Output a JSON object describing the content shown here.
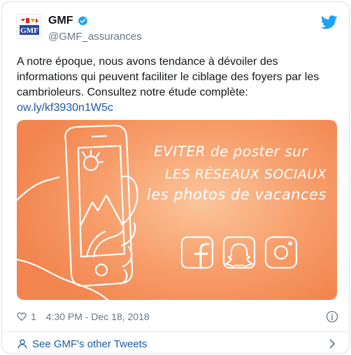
{
  "author": {
    "name": "GMF",
    "handle": "@GMF_assurances",
    "logo_text": "GMF",
    "verified": true
  },
  "tweet": {
    "text": "A notre époque, nous avons tendance à dévoiler des informations qui peuvent faciliter le ciblage des foyers par les cambrioleurs. Consultez notre étude complète:",
    "link": "ow.ly/kf3930n1W5c"
  },
  "media": {
    "line1": "EVITER de poster sur",
    "line2": "LES RÉSEAUX SOCIAUX",
    "line3": "les photos de vacances",
    "icons": [
      "facebook-icon",
      "snapchat-icon",
      "instagram-icon"
    ]
  },
  "meta": {
    "likes": "1",
    "timestamp": "4:30 PM - Dec 18, 2018"
  },
  "footer": {
    "more_tweets": "See GMF's other Tweets"
  },
  "colors": {
    "link": "#1b5aa6",
    "twitter_blue": "#1da1f2",
    "media_orange": "#f79e6b"
  }
}
